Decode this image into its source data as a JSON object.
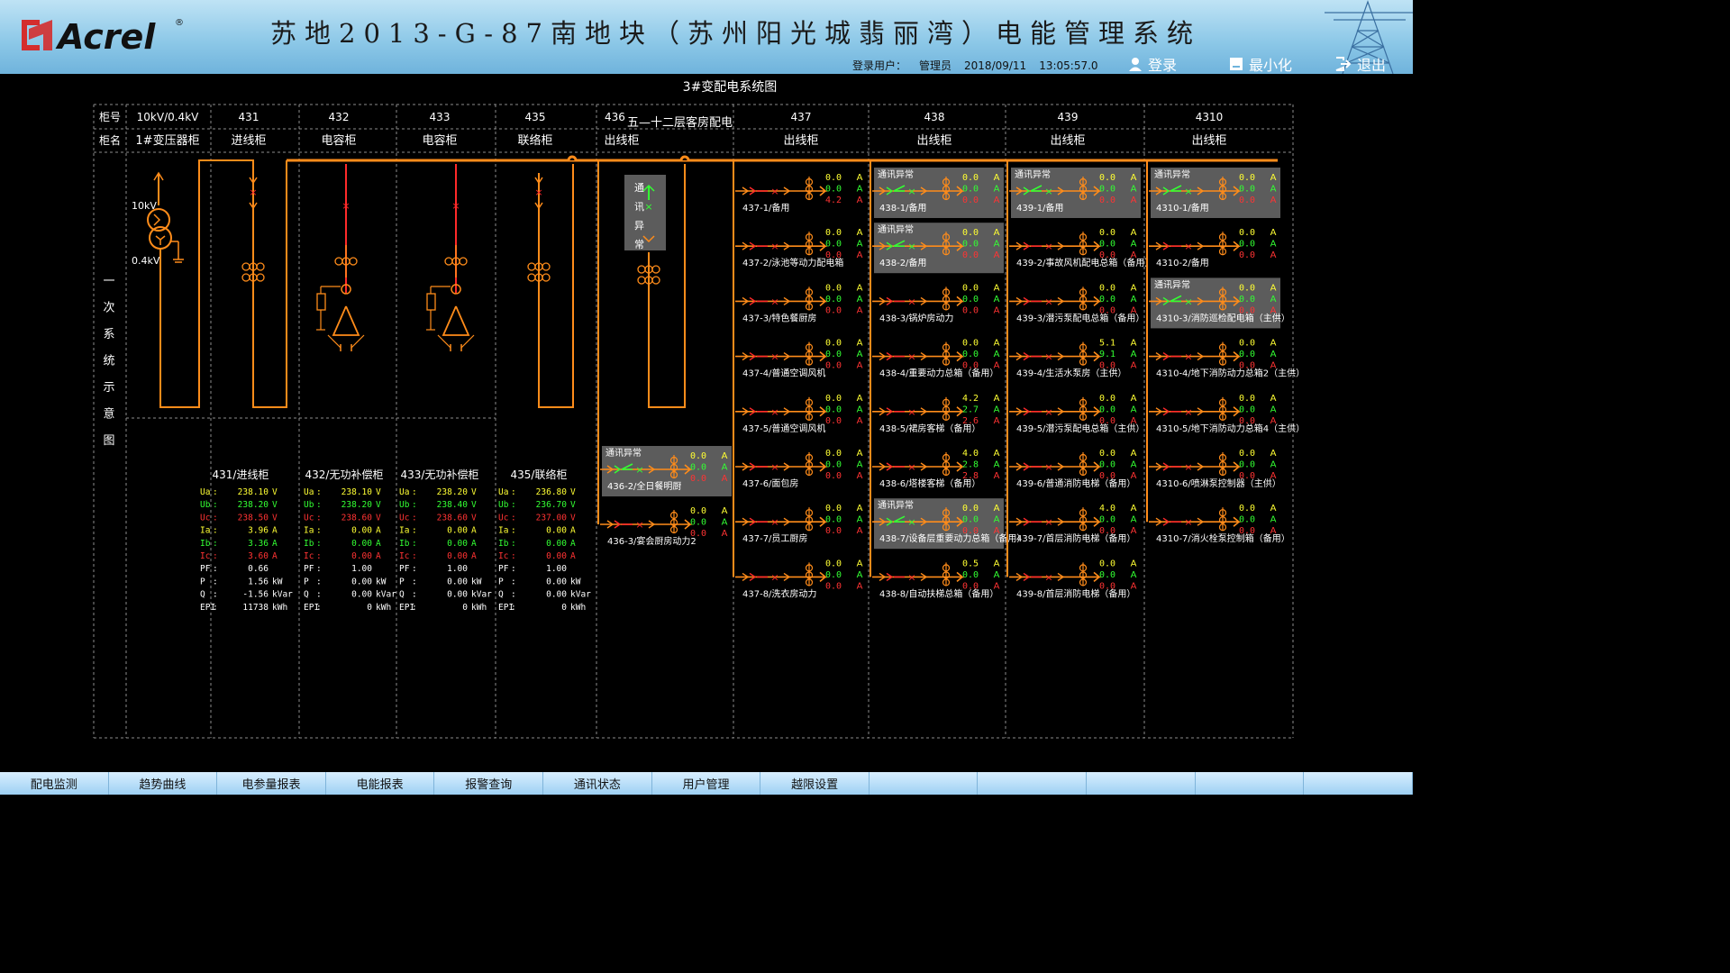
{
  "header": {
    "logo_text": "Acrel",
    "logo_mark": "®",
    "title": "苏地2013-G-87南地块（苏州阳光城翡丽湾）电能管理系统",
    "login_label": "登录用户：",
    "user": "管理员",
    "date": "2018/09/11",
    "time": "13:05:57.0",
    "buttons": {
      "login": "登录",
      "minimize": "最小化",
      "exit": "退出"
    }
  },
  "diagram": {
    "title": "3#变配电系统图",
    "row_labels": {
      "cabinet_no": "柜号",
      "cabinet_name": "柜名"
    },
    "side_label": [
      "一",
      "次",
      "系",
      "统",
      "示",
      "意",
      "图"
    ],
    "transformer_hv": "10kV",
    "transformer_lv": "0.4kV",
    "columns": [
      {
        "no": "10kV/0.4kV",
        "name": "1#变压器柜"
      },
      {
        "no": "431",
        "name": "进线柜"
      },
      {
        "no": "432",
        "name": "电容柜"
      },
      {
        "no": "433",
        "name": "电容柜"
      },
      {
        "no": "435",
        "name": "联络柜"
      },
      {
        "no": "436",
        "name": "出线柜"
      },
      {
        "no": "437",
        "name": "出线柜"
      },
      {
        "no": "438",
        "name": "出线柜"
      },
      {
        "no": "439",
        "name": "出线柜"
      },
      {
        "no": "4310",
        "name": "出线柜"
      }
    ],
    "col436_extra": "五—十二层客房配电",
    "comm_vertical": [
      "通",
      "讯",
      "异",
      "常"
    ],
    "comm_abnormal": "通讯异常",
    "unit_A": "A",
    "meters": [
      {
        "title": "431/进线柜",
        "rows": [
          {
            "k": "Ua",
            "v": "238.10",
            "u": "V"
          },
          {
            "k": "Ub",
            "v": "238.20",
            "u": "V"
          },
          {
            "k": "Uc",
            "v": "238.50",
            "u": "V"
          },
          {
            "k": "Ia",
            "v": "3.96",
            "u": "A"
          },
          {
            "k": "Ib",
            "v": "3.36",
            "u": "A"
          },
          {
            "k": "Ic",
            "v": "3.60",
            "u": "A"
          },
          {
            "k": "PF",
            "v": "0.66",
            "u": ""
          },
          {
            "k": "P",
            "v": "1.56",
            "u": "kW"
          },
          {
            "k": "Q",
            "v": "-1.56",
            "u": "kVar"
          },
          {
            "k": "EPI",
            "v": "11738",
            "u": "kWh"
          }
        ]
      },
      {
        "title": "432/无功补偿柜",
        "rows": [
          {
            "k": "Ua",
            "v": "238.10",
            "u": "V"
          },
          {
            "k": "Ub",
            "v": "238.20",
            "u": "V"
          },
          {
            "k": "Uc",
            "v": "238.60",
            "u": "V"
          },
          {
            "k": "Ia",
            "v": "0.00",
            "u": "A"
          },
          {
            "k": "Ib",
            "v": "0.00",
            "u": "A"
          },
          {
            "k": "Ic",
            "v": "0.00",
            "u": "A"
          },
          {
            "k": "PF",
            "v": "1.00",
            "u": ""
          },
          {
            "k": "P",
            "v": "0.00",
            "u": "kW"
          },
          {
            "k": "Q",
            "v": "0.00",
            "u": "kVar"
          },
          {
            "k": "EPI",
            "v": "0",
            "u": "kWh"
          }
        ]
      },
      {
        "title": "433/无功补偿柜",
        "rows": [
          {
            "k": "Ua",
            "v": "238.20",
            "u": "V"
          },
          {
            "k": "Ub",
            "v": "238.40",
            "u": "V"
          },
          {
            "k": "Uc",
            "v": "238.60",
            "u": "V"
          },
          {
            "k": "Ia",
            "v": "0.00",
            "u": "A"
          },
          {
            "k": "Ib",
            "v": "0.00",
            "u": "A"
          },
          {
            "k": "Ic",
            "v": "0.00",
            "u": "A"
          },
          {
            "k": "PF",
            "v": "1.00",
            "u": ""
          },
          {
            "k": "P",
            "v": "0.00",
            "u": "kW"
          },
          {
            "k": "Q",
            "v": "0.00",
            "u": "kVar"
          },
          {
            "k": "EPI",
            "v": "0",
            "u": "kWh"
          }
        ]
      },
      {
        "title": "435/联络柜",
        "rows": [
          {
            "k": "Ua",
            "v": "236.80",
            "u": "V"
          },
          {
            "k": "Ub",
            "v": "236.70",
            "u": "V"
          },
          {
            "k": "Uc",
            "v": "237.00",
            "u": "V"
          },
          {
            "k": "Ia",
            "v": "0.00",
            "u": "A"
          },
          {
            "k": "Ib",
            "v": "0.00",
            "u": "A"
          },
          {
            "k": "Ic",
            "v": "0.00",
            "u": "A"
          },
          {
            "k": "PF",
            "v": "1.00",
            "u": ""
          },
          {
            "k": "P",
            "v": "0.00",
            "u": "kW"
          },
          {
            "k": "Q",
            "v": "0.00",
            "u": "kVar"
          },
          {
            "k": "EPI",
            "v": "0",
            "u": "kWh"
          }
        ]
      }
    ],
    "col436_feeders": [
      {
        "label": "436-2/全日餐明厨",
        "vals": [
          "0.0",
          "0.0",
          "0.0"
        ],
        "abnormal": true
      },
      {
        "label": "436-3/宴会厨房动力2",
        "vals": [
          "0.0",
          "0.0",
          "0.0"
        ],
        "abnormal": false
      }
    ],
    "feeders": [
      [
        {
          "label": "437-1/备用",
          "vals": [
            "0.0",
            "0.0",
            "4.2"
          ],
          "abnormal": false
        },
        {
          "label": "437-2/泳池等动力配电箱",
          "vals": [
            "0.0",
            "0.0",
            "0.0"
          ],
          "abnormal": false
        },
        {
          "label": "437-3/特色餐厨房",
          "vals": [
            "0.0",
            "0.0",
            "0.0"
          ],
          "abnormal": false
        },
        {
          "label": "437-4/普通空调风机",
          "vals": [
            "0.0",
            "0.0",
            "0.0"
          ],
          "abnormal": false
        },
        {
          "label": "437-5/普通空调风机",
          "vals": [
            "0.0",
            "0.0",
            "0.0"
          ],
          "abnormal": false
        },
        {
          "label": "437-6/面包房",
          "vals": [
            "0.0",
            "0.0",
            "0.0"
          ],
          "abnormal": false
        },
        {
          "label": "437-7/员工厨房",
          "vals": [
            "0.0",
            "0.0",
            "0.0"
          ],
          "abnormal": false
        },
        {
          "label": "437-8/洗衣房动力",
          "vals": [
            "0.0",
            "0.0",
            "0.0"
          ],
          "abnormal": false
        }
      ],
      [
        {
          "label": "438-1/备用",
          "vals": [
            "0.0",
            "0.0",
            "0.0"
          ],
          "abnormal": true
        },
        {
          "label": "438-2/备用",
          "vals": [
            "0.0",
            "0.0",
            "0.0"
          ],
          "abnormal": true
        },
        {
          "label": "438-3/锅炉房动力",
          "vals": [
            "0.0",
            "0.0",
            "0.0"
          ],
          "abnormal": false
        },
        {
          "label": "438-4/重要动力总箱（备用）",
          "vals": [
            "0.0",
            "0.0",
            "0.0"
          ],
          "abnormal": false
        },
        {
          "label": "438-5/裙房客梯（备用）",
          "vals": [
            "4.2",
            "2.7",
            "2.6"
          ],
          "abnormal": false
        },
        {
          "label": "438-6/塔楼客梯（备用）",
          "vals": [
            "4.0",
            "2.8",
            "2.8"
          ],
          "abnormal": false
        },
        {
          "label": "438-7/设备层重要动力总箱（备用）",
          "vals": [
            "0.0",
            "0.0",
            "0.0"
          ],
          "abnormal": true
        },
        {
          "label": "438-8/自动扶梯总箱（备用）",
          "vals": [
            "0.5",
            "0.0",
            "0.0"
          ],
          "abnormal": false
        }
      ],
      [
        {
          "label": "439-1/备用",
          "vals": [
            "0.0",
            "0.0",
            "0.0"
          ],
          "abnormal": true
        },
        {
          "label": "439-2/事故风机配电总箱（备用）",
          "vals": [
            "0.0",
            "0.0",
            "0.0"
          ],
          "abnormal": false
        },
        {
          "label": "439-3/潜污泵配电总箱（备用）",
          "vals": [
            "0.0",
            "0.0",
            "0.0"
          ],
          "abnormal": false
        },
        {
          "label": "439-4/生活水泵房（主供）",
          "vals": [
            "5.1",
            "9.1",
            "0.0"
          ],
          "abnormal": false
        },
        {
          "label": "439-5/潜污泵配电总箱（主供）",
          "vals": [
            "0.0",
            "0.0",
            "0.0"
          ],
          "abnormal": false
        },
        {
          "label": "439-6/普通消防电梯（备用）",
          "vals": [
            "0.0",
            "0.0",
            "0.0"
          ],
          "abnormal": false
        },
        {
          "label": "439-7/首层消防电梯（备用）",
          "vals": [
            "4.0",
            "0.0",
            "0.0"
          ],
          "abnormal": false
        },
        {
          "label": "439-8/首层消防电梯（备用）",
          "vals": [
            "0.0",
            "0.0",
            "0.0"
          ],
          "abnormal": false
        }
      ],
      [
        {
          "label": "4310-1/备用",
          "vals": [
            "0.0",
            "0.0",
            "0.0"
          ],
          "abnormal": true
        },
        {
          "label": "4310-2/备用",
          "vals": [
            "0.0",
            "0.0",
            "0.0"
          ],
          "abnormal": false
        },
        {
          "label": "4310-3/消防巡检配电箱（主供）",
          "vals": [
            "0.0",
            "0.0",
            "0.0"
          ],
          "abnormal": true
        },
        {
          "label": "4310-4/地下消防动力总箱2（主供）",
          "vals": [
            "0.0",
            "0.0",
            "0.0"
          ],
          "abnormal": false
        },
        {
          "label": "4310-5/地下消防动力总箱4（主供）",
          "vals": [
            "0.0",
            "0.0",
            "0.0"
          ],
          "abnormal": false
        },
        {
          "label": "4310-6/喷淋泵控制器（主供）",
          "vals": [
            "0.0",
            "0.0",
            "0.0"
          ],
          "abnormal": false
        },
        {
          "label": "4310-7/消火栓泵控制箱（备用）",
          "vals": [
            "0.0",
            "0.0",
            "0.0"
          ],
          "abnormal": false
        }
      ]
    ]
  },
  "nav": [
    "配电监测",
    "趋势曲线",
    "电参量报表",
    "电能报表",
    "报警查询",
    "通讯状态",
    "用户管理",
    "越限设置",
    "",
    "",
    "",
    "",
    ""
  ],
  "colors": {
    "bus": "#ff8c1a",
    "breaker": "#ff2a2a",
    "closed": "#33ff33",
    "grid": "#8c8c8c",
    "abnormal_bg": "#5c5c5c",
    "value_yellow": "#ffff33",
    "value_green": "#33ff33",
    "value_red": "#ff3333"
  }
}
